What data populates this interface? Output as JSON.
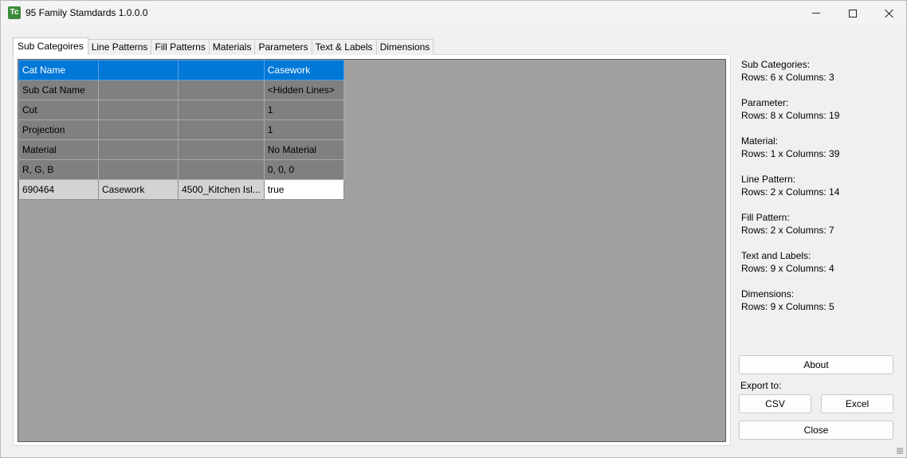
{
  "window": {
    "title": "95 Family Stamdards 1.0.0.0",
    "icon_glyph": "Tc"
  },
  "tabs": [
    {
      "label": "Sub Categoires",
      "active": true
    },
    {
      "label": "Line Patterns",
      "active": false
    },
    {
      "label": "Fill Patterns",
      "active": false
    },
    {
      "label": "Materials",
      "active": false
    },
    {
      "label": "Parameters",
      "active": false
    },
    {
      "label": "Text & Labels",
      "active": false
    },
    {
      "label": "Dimensions",
      "active": false
    }
  ],
  "grid": {
    "header": [
      "Cat Name",
      "",
      "",
      "Casework"
    ],
    "rows": [
      [
        "Sub Cat Name",
        "",
        "",
        "<Hidden Lines>"
      ],
      [
        "Cut",
        "",
        "",
        "1"
      ],
      [
        "Projection",
        "",
        "",
        "1"
      ],
      [
        "Material",
        "",
        "",
        "No Material"
      ],
      [
        "R, G, B",
        "",
        "",
        "0, 0, 0"
      ]
    ],
    "data_row": [
      "690464",
      "Casework",
      "4500_Kitchen Isl...",
      "true"
    ]
  },
  "info": [
    {
      "label": "Sub Categories:",
      "value": "Rows: 6 x Columns: 3"
    },
    {
      "label": "Parameter:",
      "value": "Rows: 8 x Columns: 19"
    },
    {
      "label": "Material:",
      "value": "Rows: 1 x Columns: 39"
    },
    {
      "label": "Line Pattern:",
      "value": "Rows: 2 x Columns: 14"
    },
    {
      "label": "Fill Pattern:",
      "value": "Rows: 2 x Columns: 7"
    },
    {
      "label": "Text and Labels:",
      "value": "Rows: 9 x Columns: 4"
    },
    {
      "label": "Dimensions:",
      "value": "Rows: 9 x Columns: 5"
    }
  ],
  "buttons": {
    "about": "About",
    "export_label": "Export to:",
    "csv": "CSV",
    "excel": "Excel",
    "close": "Close"
  },
  "colors": {
    "selection": "#0078d7",
    "grid_background": "#a0a0a0",
    "grey_row": "#808080",
    "data_row": "#d3d3d3"
  }
}
